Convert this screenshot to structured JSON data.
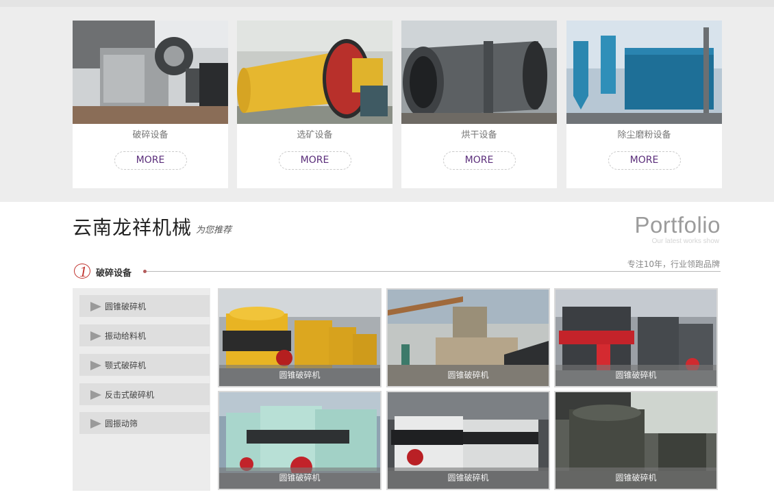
{
  "categories": [
    {
      "title": "破碎设备",
      "more": "MORE"
    },
    {
      "title": "选矿设备",
      "more": "MORE"
    },
    {
      "title": "烘干设备",
      "more": "MORE"
    },
    {
      "title": "除尘磨粉设备",
      "more": "MORE"
    }
  ],
  "section": {
    "title": "云南龙祥机械",
    "subtitle": "为您推荐",
    "portfolio": "Portfolio",
    "portfolio_sub": "Our latest works show",
    "slogan": "专注10年，行业领跑品牌",
    "tab_number": "1",
    "tab_label": "破碎设备"
  },
  "sidebar": {
    "items": [
      {
        "label": "圆锥破碎机"
      },
      {
        "label": "振动给料机"
      },
      {
        "label": "颚式破碎机"
      },
      {
        "label": "反击式破碎机"
      },
      {
        "label": "圆振动筛"
      }
    ]
  },
  "products": [
    {
      "caption": "圆锥破碎机"
    },
    {
      "caption": "圆锥破碎机"
    },
    {
      "caption": "圆锥破碎机"
    },
    {
      "caption": "圆锥破碎机"
    },
    {
      "caption": "圆锥破碎机"
    },
    {
      "caption": "圆锥破碎机"
    }
  ],
  "colors": {
    "more_text": "#5a2d7a",
    "tab_number": "#c0312c",
    "band_bg": "#ededed"
  }
}
